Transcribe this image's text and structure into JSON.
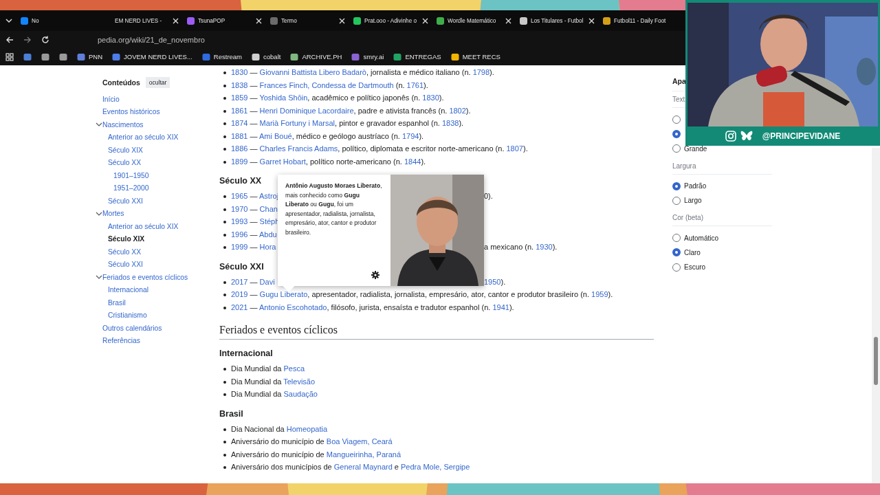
{
  "tabs": [
    {
      "title": "No",
      "color": "#1185fe",
      "close_button": false
    },
    {
      "title": "EM NERD LIVES -",
      "close_button": true
    },
    {
      "title": "TsunaPOP",
      "color": "#9b5cf6",
      "close_button": true
    },
    {
      "title": "Termo",
      "color": "#6b6b6b",
      "close_button": true
    },
    {
      "title": "Prat.ooo - Adivinhe o",
      "color": "#22c55e",
      "close_button": true
    },
    {
      "title": "Wordle Matemático",
      "color": "#3fae4a",
      "close_button": true
    },
    {
      "title": "Los Titulares - Futbol",
      "color": "#c8c8c8",
      "close_button": true
    },
    {
      "title": "Futbol11 - Daily Foot",
      "color": "#d4a017",
      "close_button": false
    }
  ],
  "address": {
    "url": "pedia.org/wiki/21_de_novembro"
  },
  "bookmarks": [
    {
      "color": "#4a7fd6"
    },
    {
      "color": "#9a9a9a"
    },
    {
      "color": "#9a9a9a"
    },
    {
      "label": "PNN",
      "color": "#5f7fd8"
    },
    {
      "label": "JOVEM NERD LIVES...",
      "color": "#4e7de9"
    },
    {
      "label": "Restream",
      "color": "#2f6be0"
    },
    {
      "label": "cobalt",
      "color": "#cfcfcf"
    },
    {
      "label": "ARCHIVE.PH",
      "color": "#7fb77e"
    },
    {
      "label": "smry.ai",
      "color": "#8a63d2"
    },
    {
      "label": "ENTREGAS",
      "color": "#1fa463"
    },
    {
      "label": "MEET RECS",
      "color": "#f2b400"
    }
  ],
  "toc": {
    "title": "Conteúdos",
    "hide_button": "ocultar",
    "items": [
      {
        "label": "Início",
        "selected": false
      },
      {
        "label": "Eventos históricos",
        "selected": false
      },
      {
        "label": "Nascimentos",
        "selected": false,
        "expanded": true,
        "children": [
          {
            "label": "Anterior ao século XIX",
            "selected": false
          },
          {
            "label": "Século XIX",
            "selected": false
          },
          {
            "label": "Século XX",
            "selected": false,
            "children": [
              {
                "label": "1901–1950",
                "selected": false
              },
              {
                "label": "1951–2000",
                "selected": false
              }
            ]
          },
          {
            "label": "Século XXI",
            "selected": false
          }
        ]
      },
      {
        "label": "Mortes",
        "selected": false,
        "expanded": true,
        "children": [
          {
            "label": "Anterior ao século XIX",
            "selected": false
          },
          {
            "label": "Século XIX",
            "selected": true
          },
          {
            "label": "Século XX",
            "selected": false
          },
          {
            "label": "Século XXI",
            "selected": false
          }
        ]
      },
      {
        "label": "Feriados e eventos cíclicos",
        "selected": false,
        "expanded": true,
        "children": [
          {
            "label": "Internacional",
            "selected": false
          },
          {
            "label": "Brasil",
            "selected": false
          },
          {
            "label": "Cristianismo",
            "selected": false
          }
        ]
      },
      {
        "label": "Outros calendários",
        "selected": false
      },
      {
        "label": "Referências",
        "selected": false
      }
    ]
  },
  "content": [
    {
      "kind": "list",
      "items": [
        {
          "parts": [
            {
              "link": "1830"
            },
            " — ",
            {
              "link": "Giovanni Battista Libero Badarò"
            },
            ", jornalista e médico italiano (n. ",
            {
              "link": "1798"
            },
            ")."
          ]
        },
        {
          "parts": [
            {
              "link": "1838"
            },
            " — ",
            {
              "link": "Frances Finch, Condessa de Dartmouth"
            },
            " (n. ",
            {
              "link": "1761"
            },
            ")."
          ]
        },
        {
          "parts": [
            {
              "link": "1859"
            },
            " — ",
            {
              "link": "Yoshida Shōin"
            },
            ", acadêmico e político japonês (n. ",
            {
              "link": "1830"
            },
            ")."
          ]
        },
        {
          "parts": [
            {
              "link": "1861"
            },
            " — ",
            {
              "link": "Henri Dominique Lacordaire"
            },
            ", padre e ativista francês (n. ",
            {
              "link": "1802"
            },
            ")."
          ]
        },
        {
          "parts": [
            {
              "link": "1874"
            },
            " — ",
            {
              "link": "Marià Fortuny i Marsal"
            },
            ", pintor e gravador espanhol (n. ",
            {
              "link": "1838"
            },
            ")."
          ]
        },
        {
          "parts": [
            {
              "link": "1881"
            },
            " — ",
            {
              "link": "Ami Boué"
            },
            ", médico e geólogo austríaco (n. ",
            {
              "link": "1794"
            },
            ")."
          ]
        },
        {
          "parts": [
            {
              "link": "1886"
            },
            " — ",
            {
              "link": "Charles Francis Adams"
            },
            ", político, diplomata e escritor norte-americano (n. ",
            {
              "link": "1807"
            },
            ")."
          ]
        },
        {
          "parts": [
            {
              "link": "1899"
            },
            " — ",
            {
              "link": "Garret Hobart"
            },
            ", político norte-americano (n. ",
            {
              "link": "1844"
            },
            ")."
          ]
        }
      ]
    },
    {
      "kind": "h3",
      "text": "Século XX"
    },
    {
      "kind": "list",
      "items": [
        {
          "parts": [
            {
              "link": "1965"
            },
            " — ",
            {
              "link": "Astroj"
            }
          ],
          "tail": [
            "0)."
          ]
        },
        {
          "parts": [
            {
              "link": "1970"
            },
            " — ",
            {
              "link": "Chan"
            }
          ]
        },
        {
          "parts": [
            {
              "link": "1993"
            },
            " — ",
            {
              "link": "Stéph"
            }
          ]
        },
        {
          "parts": [
            {
              "link": "1996"
            },
            " — ",
            {
              "link": "Abdu"
            }
          ]
        },
        {
          "parts": [
            {
              "link": "1999"
            },
            " — ",
            {
              "link": "Hora"
            }
          ],
          "tail": [
            "a mexicano (n. ",
            {
              "link": "1930"
            },
            ")."
          ]
        }
      ]
    },
    {
      "kind": "h3",
      "text": "Século XXI"
    },
    {
      "kind": "list",
      "items": [
        {
          "parts": [
            {
              "link": "2017"
            },
            " — ",
            {
              "link": "Davi"
            }
          ],
          "tail": [
            {
              "link": "1950"
            },
            ")."
          ]
        },
        {
          "parts": [
            {
              "link": "2019"
            },
            " — ",
            {
              "link": "Gugu Liberato"
            },
            ", apresentador, radialista, jornalista, empresário, ator, cantor e produtor brasileiro (n. ",
            {
              "link": "1959"
            },
            ")."
          ]
        },
        {
          "parts": [
            {
              "link": "2021"
            },
            " — ",
            {
              "link": "Antonio Escohotado"
            },
            ", filósofo, jurista, ensaísta e tradutor espanhol (n. ",
            {
              "link": "1941"
            },
            ")."
          ]
        }
      ]
    },
    {
      "kind": "h2",
      "text": "Feriados e eventos cíclicos"
    },
    {
      "kind": "h3",
      "text": "Internacional"
    },
    {
      "kind": "list",
      "items": [
        {
          "parts": [
            "Dia Mundial da ",
            {
              "link": "Pesca"
            }
          ]
        },
        {
          "parts": [
            "Dia Mundial da ",
            {
              "link": "Televisão"
            }
          ]
        },
        {
          "parts": [
            "Dia Mundial da ",
            {
              "link": "Saudação"
            }
          ]
        }
      ]
    },
    {
      "kind": "h3",
      "text": "Brasil"
    },
    {
      "kind": "list",
      "items": [
        {
          "parts": [
            "Dia Nacional da ",
            {
              "link": "Homeopatia"
            }
          ]
        },
        {
          "parts": [
            "Aniversário do município de ",
            {
              "link": "Boa Viagem, Ceará"
            }
          ]
        },
        {
          "parts": [
            "Aniversário do município de ",
            {
              "link": "Mangueirinha, Paraná"
            }
          ]
        },
        {
          "parts": [
            "Aniversário dos municípios de ",
            {
              "link": "General Maynard"
            },
            " e ",
            {
              "link": "Pedra Mole, Sergipe"
            }
          ]
        }
      ]
    }
  ],
  "popup": {
    "text": "**Antônio Augusto Moraes Liberato**, mais conhecido como **Gugu Liberato** ou **Gugu**, foi um apresentador, radialista, jornalista, empresário, ator, cantor e produtor brasileiro."
  },
  "tools": {
    "title": "Apa",
    "groups": [
      {
        "label": "Text",
        "options": [
          {
            "selected": false
          },
          {
            "selected": true
          },
          {
            "label": "Grande",
            "selected": false
          }
        ]
      },
      {
        "label": "Largura",
        "options": [
          {
            "label": "Padrão",
            "selected": true
          },
          {
            "label": "Largo",
            "selected": false
          }
        ]
      },
      {
        "label": "Cor (beta)",
        "options": [
          {
            "label": "Automático",
            "selected": false
          },
          {
            "label": "Claro",
            "selected": true
          },
          {
            "label": "Escuro",
            "selected": false
          }
        ]
      }
    ]
  },
  "webcam": {
    "handle": "@PRINCIPEVIDANE"
  }
}
